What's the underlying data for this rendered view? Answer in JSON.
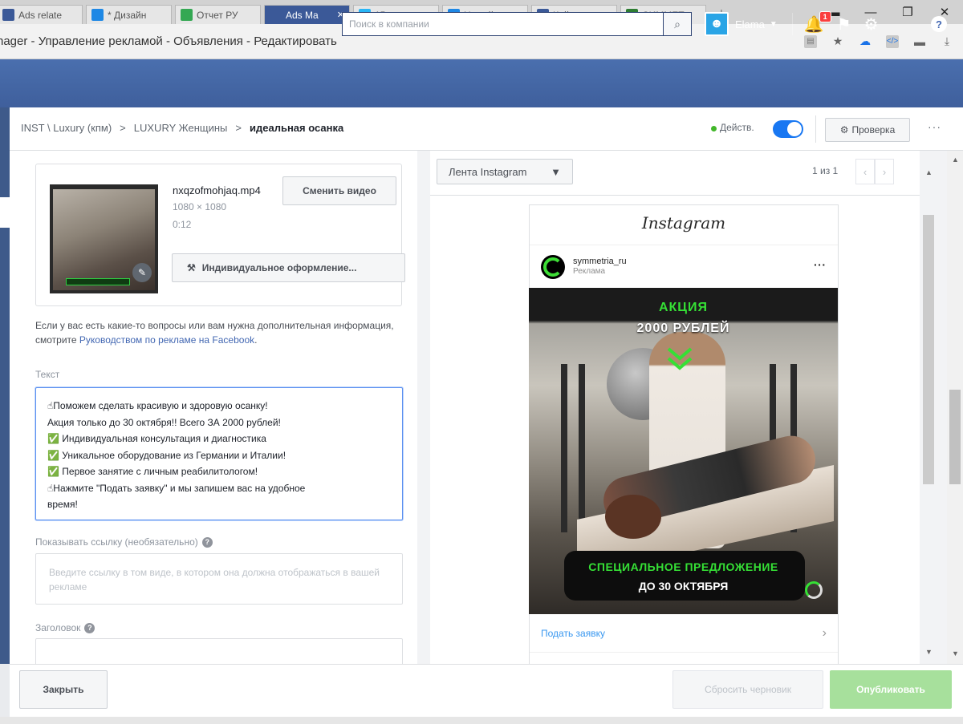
{
  "browser": {
    "tabs": [
      {
        "label": "Ads relate",
        "color": "#3b5998",
        "active": false
      },
      {
        "label": "* Дизайн",
        "color": "#1e88e5",
        "active": false
      },
      {
        "label": "Отчет РУ",
        "color": "#34a853",
        "active": false
      },
      {
        "label": "Ads Ma",
        "color": "#3b5998",
        "active": true
      },
      {
        "label": "15 полез",
        "color": "#29b6f6",
        "active": false
      },
      {
        "label": "Новый до",
        "color": "#1e88e5",
        "active": false
      },
      {
        "label": "Кейс: про",
        "color": "#3b5998",
        "active": false
      },
      {
        "label": "СИММЕТ",
        "color": "#2e7d32",
        "active": false
      }
    ],
    "new_tab": "+",
    "url_text": "nager - Управление рекламой - Объявления - Редактировать"
  },
  "fb_header": {
    "search_placeholder": "Поиск в компании",
    "user_name": "Elama",
    "notification_count": "1"
  },
  "breadcrumb": {
    "items": [
      "INST \\ Luxury (кпм)",
      "LUXURY Женщины",
      "идеальная осанка"
    ],
    "separator": ">",
    "status_label": "Действ.",
    "review_label": "Проверка",
    "more_label": "···"
  },
  "media": {
    "file_name": "nxqzofmohjaq.mp4",
    "dimensions": "1080 × 1080",
    "duration": "0:12",
    "change_video_label": "Сменить видео",
    "custom_design_label": "Индивидуальное оформление..."
  },
  "help": {
    "text_before": "Если у вас есть какие-то вопросы или вам нужна дополнительная информация, смотрите ",
    "link_text": "Руководством по рекламе на Facebook",
    "text_after": "."
  },
  "fields": {
    "text_label": "Текст",
    "text_lines": [
      "☝Поможем сделать красивую и здоровую осанку!",
      "Акция только до 30 октября!!  Всего ЗА 2000 рублей!",
      "✅ Индивидуальная консультация и диагностика",
      "✅ Уникальное оборудование из Германии и Италии!",
      "✅ Первое занятие с личным реабилитологом!",
      "☝Нажмите \"Подать заявку\" и мы запишем вас на удобное",
      "время!"
    ],
    "link_label": "Показывать ссылку (необязательно)",
    "link_placeholder": "Введите ссылку в том виде, в котором она должна отображаться в вашей рекламе",
    "headline_label": "Заголовок"
  },
  "preview": {
    "placement": "Лента Instagram",
    "pager": "1 из 1",
    "ig_logo": "Instagram",
    "account_name": "symmetria_ru",
    "sponsored": "Реклама",
    "promo_line1": "АКЦИЯ",
    "promo_line2": "2000 РУБЛЕЙ",
    "promo_line3": "СПЕЦИАЛЬНОЕ ПРЕДЛОЖЕНИЕ",
    "promo_line4": "ДО 30 ОКТЯБРЯ",
    "cta_label": "Подать заявку"
  },
  "footer": {
    "close_label": "Закрыть",
    "discard_label": "Сбросить черновик",
    "publish_label": "Опубликовать"
  },
  "colors": {
    "fb_blue": "#4267b2",
    "accent_green": "#35e035",
    "publish_green": "#a7e09c",
    "toggle_blue": "#1877f2"
  }
}
